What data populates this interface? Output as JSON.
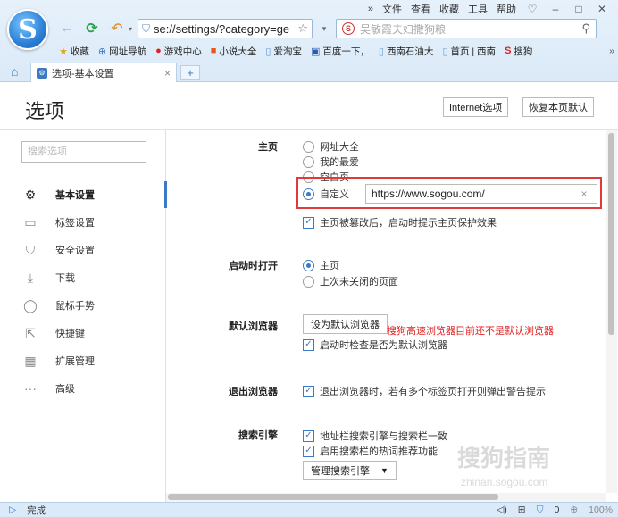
{
  "window": {
    "menu": [
      "文件",
      "查看",
      "收藏",
      "工具",
      "帮助"
    ],
    "more_icon": "»",
    "window_buttons": [
      "♡",
      "–",
      "□",
      "✕"
    ]
  },
  "navbar": {
    "address_value": "se://settings/?category=ge",
    "search_placeholder": "吴敏霞夫妇撒狗粮"
  },
  "bookmarks": [
    {
      "icon": "★",
      "label": "收藏"
    },
    {
      "icon": "⊕",
      "label": "网址导航"
    },
    {
      "icon": "●",
      "label": "游戏中心"
    },
    {
      "icon": "■",
      "label": "小说大全"
    },
    {
      "icon": "▯",
      "label": "爱淘宝"
    },
    {
      "icon": "▣",
      "label": "百度一下，"
    },
    {
      "icon": "▯",
      "label": "西南石油大"
    },
    {
      "icon": "▯",
      "label": "首页 | 西南"
    },
    {
      "icon": "S",
      "label": "搜狗"
    }
  ],
  "bookmarks_more": "»",
  "tab": {
    "label": "选项-基本设置",
    "close": "×",
    "new_tab": "+"
  },
  "page": {
    "title": "选项",
    "internet_options_btn": "Internet选项",
    "restore_default_btn": "恢复本页默认"
  },
  "sidebar": {
    "search_placeholder": "搜索选项",
    "items": [
      {
        "icon": "⚙",
        "label": "基本设置"
      },
      {
        "icon": "▭",
        "label": "标签设置"
      },
      {
        "icon": "⛉",
        "label": "安全设置"
      },
      {
        "icon": "⤓",
        "label": "下载"
      },
      {
        "icon": "◯",
        "label": "鼠标手势"
      },
      {
        "icon": "⇱",
        "label": "快捷键"
      },
      {
        "icon": "▦",
        "label": "扩展管理"
      },
      {
        "icon": "···",
        "label": "高级"
      }
    ]
  },
  "homepage": {
    "label": "主页",
    "options": [
      "网址大全",
      "我的最爱",
      "空白页",
      "自定义"
    ],
    "selected": "自定义",
    "custom_url": "https://www.sogou.com/",
    "clear": "×",
    "protect_check": "主页被篡改后，启动时提示主页保护效果"
  },
  "startup": {
    "label": "启动时打开",
    "options": [
      "主页",
      "上次未关闭的页面"
    ],
    "selected": "主页"
  },
  "default_browser": {
    "label": "默认浏览器",
    "button": "设为默认浏览器",
    "warning": "搜狗高速浏览器目前还不是默认浏览器",
    "check": "启动时检查是否为默认浏览器"
  },
  "exit": {
    "label": "退出浏览器",
    "check": "退出浏览器时，若有多个标签页打开则弹出警告提示"
  },
  "search_engine": {
    "label": "搜索引擎",
    "check1": "地址栏搜索引擎与搜索栏一致",
    "check2": "启用搜索栏的热词推荐功能",
    "manage_btn": "管理搜索引擎",
    "dropdown_arrow": "▼"
  },
  "watermark": {
    "main": "搜狗指南",
    "sub": "zhinan.sogou.com"
  },
  "status": {
    "text": "完成",
    "zoom": "100%",
    "count": "0"
  }
}
